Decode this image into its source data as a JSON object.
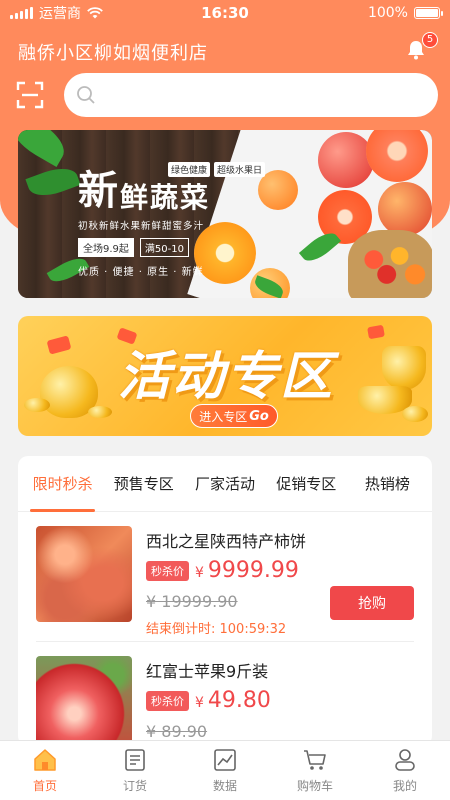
{
  "status_bar": {
    "carrier": "运营商",
    "time": "16:30",
    "battery": "100%",
    "battery_level": 1.0
  },
  "header": {
    "store_name": "融侨小区柳如烟便利店",
    "notification_count": "5"
  },
  "search": {
    "placeholder": "",
    "value": ""
  },
  "banner": {
    "title_big": "新",
    "title_rest": "鲜蔬菜",
    "tag_1": "绿色健康",
    "tag_2": "超级水果日",
    "subtitle": "初秋新鲜水果新鲜甜蜜多汁",
    "promo_1": "全场9.9起",
    "promo_2": "满50-10",
    "footer": "优质 · 便捷 · 原生 · 新鲜"
  },
  "promo_banner": {
    "title": "活动专区",
    "button_label": "进入专区",
    "button_go": "Go"
  },
  "tabs": [
    {
      "label": "限时秒杀",
      "active": true
    },
    {
      "label": "预售专区",
      "active": false
    },
    {
      "label": "厂家活动",
      "active": false
    },
    {
      "label": "促销专区",
      "active": false
    },
    {
      "label": "热销榜",
      "active": false
    }
  ],
  "products": [
    {
      "name": "西北之星陕西特产柿饼",
      "tag": "秒杀价",
      "currency": "¥",
      "price": "9999.99",
      "old_price": "¥ 19999.90",
      "countdown": "结束倒计时: 100:59:32",
      "buy_label": "抢购"
    },
    {
      "name": "红富士苹果9斤装",
      "tag": "秒杀价",
      "currency": "¥",
      "price": "49.80",
      "old_price": "¥ 89.90"
    }
  ],
  "tabbar": [
    {
      "label": "首页",
      "icon": "home-icon",
      "active": true
    },
    {
      "label": "订货",
      "icon": "order-icon",
      "active": false
    },
    {
      "label": "数据",
      "icon": "data-icon",
      "active": false
    },
    {
      "label": "购物车",
      "icon": "cart-icon",
      "active": false
    },
    {
      "label": "我的",
      "icon": "profile-icon",
      "active": false
    }
  ],
  "colors": {
    "accent": "#ff6e3a",
    "header_bg": "#ff8a5c",
    "price_red": "#f0484a"
  }
}
